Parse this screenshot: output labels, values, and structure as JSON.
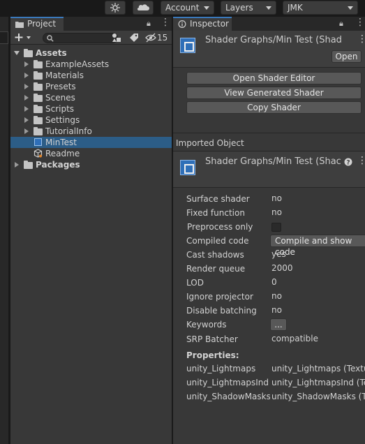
{
  "toolbar": {
    "account_label": "Account",
    "layers_label": "Layers",
    "layout_label": "JMK"
  },
  "project": {
    "tab_label": "Project",
    "search_placeholder": "",
    "hidden_count": "15",
    "tree": [
      {
        "label": "Assets",
        "level": 0,
        "type": "folder-open"
      },
      {
        "label": "ExampleAssets",
        "level": 1,
        "type": "folder"
      },
      {
        "label": "Materials",
        "level": 1,
        "type": "folder"
      },
      {
        "label": "Presets",
        "level": 1,
        "type": "folder"
      },
      {
        "label": "Scenes",
        "level": 1,
        "type": "folder"
      },
      {
        "label": "Scripts",
        "level": 1,
        "type": "folder"
      },
      {
        "label": "Settings",
        "level": 1,
        "type": "folder"
      },
      {
        "label": "TutorialInfo",
        "level": 1,
        "type": "folder"
      },
      {
        "label": "MinTest",
        "level": 1,
        "type": "shader",
        "selected": true
      },
      {
        "label": "Readme",
        "level": 1,
        "type": "asset"
      },
      {
        "label": "Packages",
        "level": 0,
        "type": "folder"
      }
    ]
  },
  "inspector": {
    "tab_label": "Inspector",
    "header_title": "Shader Graphs/Min Test (Shad",
    "open_button": "Open",
    "buttons": [
      "Open Shader Editor",
      "View Generated Shader",
      "Copy Shader"
    ],
    "imported_object_label": "Imported Object",
    "imported_title": "Shader Graphs/Min Test (Shac",
    "properties": [
      {
        "key": "Surface shader",
        "value": "no"
      },
      {
        "key": "Fixed function",
        "value": "no"
      },
      {
        "key": "Preprocess only",
        "value": ""
      },
      {
        "key": "Compiled code",
        "value": "Compile and show code"
      },
      {
        "key": "Cast shadows",
        "value": "yes"
      },
      {
        "key": "Render queue",
        "value": "2000"
      },
      {
        "key": "LOD",
        "value": "0"
      },
      {
        "key": "Ignore projector",
        "value": "no"
      },
      {
        "key": "Disable batching",
        "value": "no"
      },
      {
        "key": "Keywords",
        "value": "..."
      },
      {
        "key": "SRP Batcher",
        "value": "compatible"
      }
    ],
    "properties_heading": "Properties:",
    "shader_props": [
      {
        "key": "unity_Lightmaps",
        "value": "unity_Lightmaps (Textu"
      },
      {
        "key": "unity_LightmapsInd",
        "value": "unity_LightmapsInd (Te"
      },
      {
        "key": "unity_ShadowMasks",
        "value": "unity_ShadowMasks (T"
      }
    ]
  }
}
